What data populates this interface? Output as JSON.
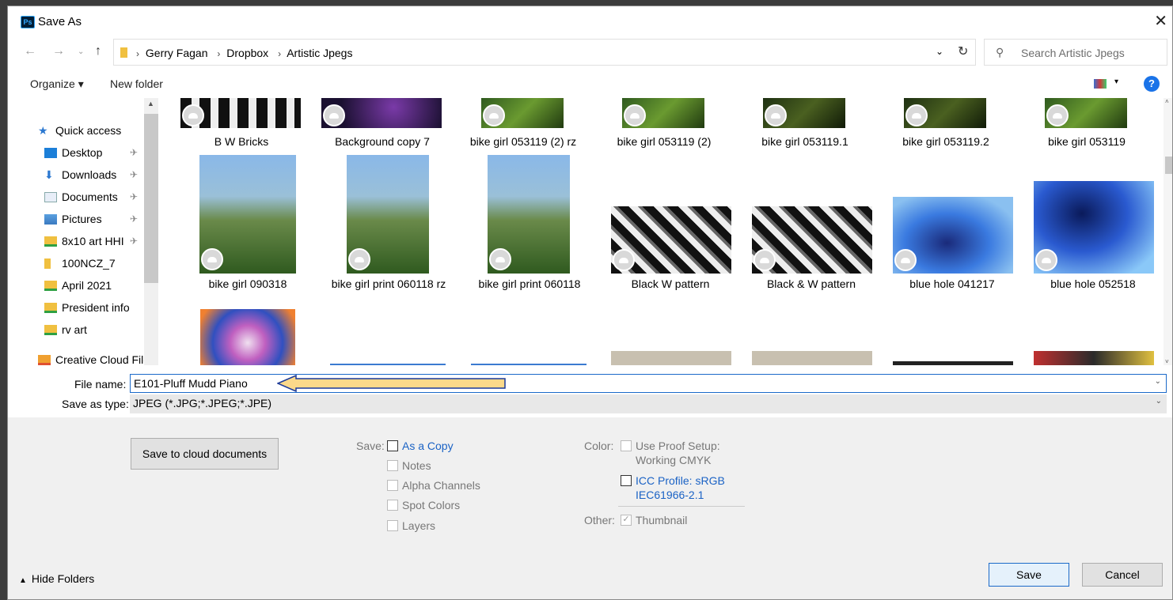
{
  "window": {
    "app_badge": "Ps",
    "title": "Save As"
  },
  "address": {
    "crumbs": [
      "Gerry Fagan",
      "Dropbox",
      "Artistic Jpegs"
    ],
    "search_placeholder": "Search Artistic Jpegs"
  },
  "toolbar": {
    "organize": "Organize ▾",
    "new_folder": "New folder",
    "help": "?"
  },
  "sidebar": {
    "items": [
      {
        "label": "Quick access"
      },
      {
        "label": "Desktop"
      },
      {
        "label": "Downloads"
      },
      {
        "label": "Documents"
      },
      {
        "label": "Pictures"
      },
      {
        "label": "8x10 art HHI"
      },
      {
        "label": "100NCZ_7"
      },
      {
        "label": "April 2021"
      },
      {
        "label": "President info"
      },
      {
        "label": "rv art"
      },
      {
        "label": "Creative Cloud Fil‹"
      }
    ]
  },
  "files": {
    "row1": [
      "B W Bricks",
      "Background copy 7",
      "bike girl 053119 (2) rz",
      "bike girl 053119 (2)",
      "bike girl 053119.1",
      "bike girl 053119.2",
      "bike girl 053119"
    ],
    "row2": [
      "bike girl 090318",
      "bike girl print 060118 rz",
      "bike girl print 060118",
      "Black  W pattern",
      "Black & W pattern",
      "blue hole 041217",
      "blue hole 052518"
    ]
  },
  "form": {
    "file_name_label": "File name:",
    "file_name_value": "E101-Pluff Mudd Piano",
    "save_type_label": "Save as type:",
    "save_type_value": "JPEG (*.JPG;*.JPEG;*.JPE)"
  },
  "options": {
    "cloud_button": "Save to cloud documents",
    "save_label": "Save:",
    "as_copy": "As a Copy",
    "notes": "Notes",
    "alpha": "Alpha Channels",
    "spot": "Spot Colors",
    "layers": "Layers",
    "color_label": "Color:",
    "proof_setup": "Use Proof Setup:",
    "working_cmyk": "Working CMYK",
    "icc_profile": "ICC Profile:  sRGB",
    "icc_profile_2": "IEC61966-2.1",
    "other_label": "Other:",
    "thumbnail": "Thumbnail"
  },
  "bottom": {
    "hide_folders": "Hide Folders",
    "save": "Save",
    "cancel": "Cancel"
  }
}
